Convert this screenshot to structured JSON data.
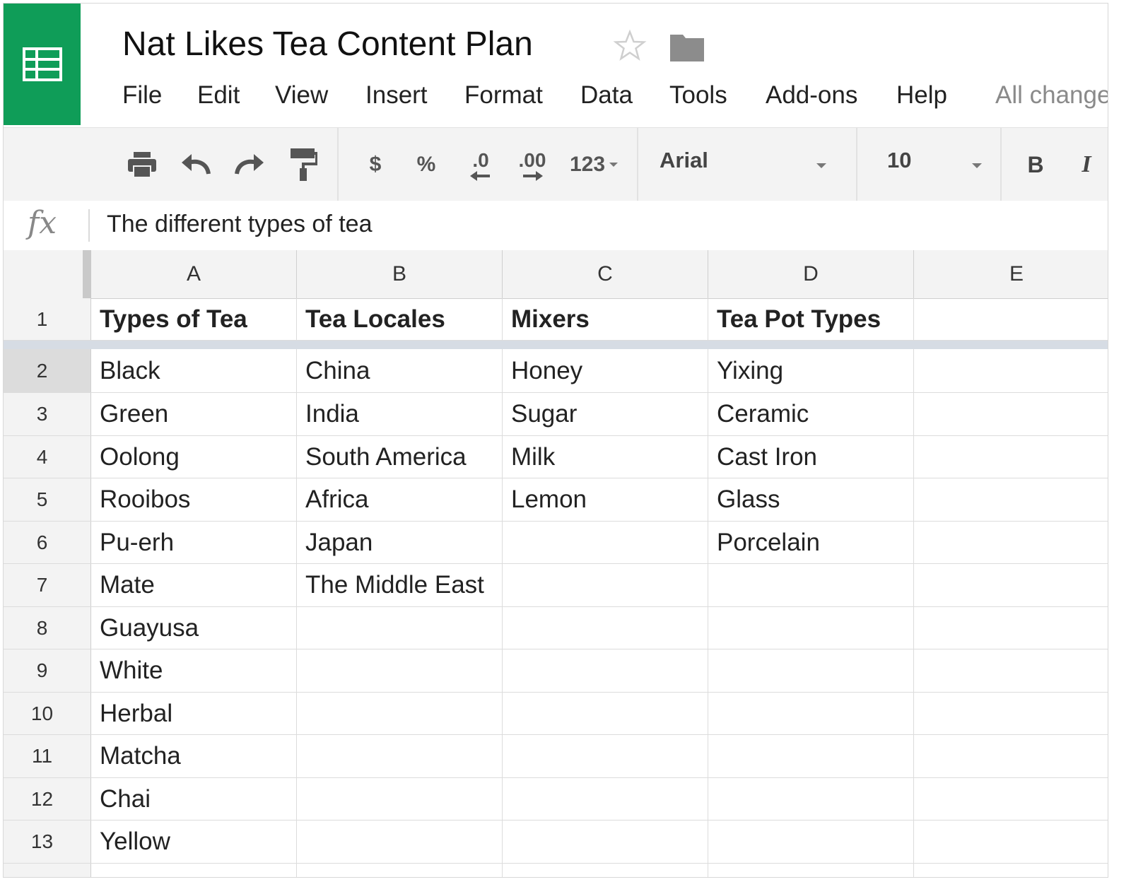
{
  "app": {
    "title": "Nat Likes Tea Content Plan",
    "save_status": "All changes saved in Drive",
    "accent_color": "#0f9d58"
  },
  "menu": [
    "File",
    "Edit",
    "View",
    "Insert",
    "Format",
    "Data",
    "Tools",
    "Add-ons",
    "Help"
  ],
  "toolbar": {
    "currency": "$",
    "percent": "%",
    "decrease_decimal": ".0",
    "increase_decimal": ".00",
    "more_formats": "123",
    "font": "Arial",
    "font_size": "10",
    "bold": "B",
    "italic": "I"
  },
  "formula": {
    "label": "fx",
    "value": "The different types of tea"
  },
  "columns": [
    "A",
    "B",
    "C",
    "D",
    "E"
  ],
  "rows": [
    {
      "num": "1",
      "cells": [
        "Types of Tea",
        "Tea Locales",
        "Mixers",
        "Tea Pot Types",
        ""
      ]
    },
    {
      "num": "2",
      "cells": [
        "Black",
        "China",
        "Honey",
        "Yixing",
        ""
      ]
    },
    {
      "num": "3",
      "cells": [
        "Green",
        "India",
        "Sugar",
        "Ceramic",
        ""
      ]
    },
    {
      "num": "4",
      "cells": [
        "Oolong",
        "South America",
        "Milk",
        "Cast Iron",
        ""
      ]
    },
    {
      "num": "5",
      "cells": [
        "Rooibos",
        "Africa",
        "Lemon",
        "Glass",
        ""
      ]
    },
    {
      "num": "6",
      "cells": [
        "Pu-erh",
        "Japan",
        "",
        "Porcelain",
        ""
      ]
    },
    {
      "num": "7",
      "cells": [
        "Mate",
        "The Middle East",
        "",
        "",
        ""
      ]
    },
    {
      "num": "8",
      "cells": [
        "Guayusa",
        "",
        "",
        "",
        ""
      ]
    },
    {
      "num": "9",
      "cells": [
        "White",
        "",
        "",
        "",
        ""
      ]
    },
    {
      "num": "10",
      "cells": [
        "Herbal",
        "",
        "",
        "",
        ""
      ]
    },
    {
      "num": "11",
      "cells": [
        "Matcha",
        "",
        "",
        "",
        ""
      ]
    },
    {
      "num": "12",
      "cells": [
        "Chai",
        "",
        "",
        "",
        ""
      ]
    },
    {
      "num": "13",
      "cells": [
        "Yellow",
        "",
        "",
        "",
        ""
      ]
    }
  ]
}
